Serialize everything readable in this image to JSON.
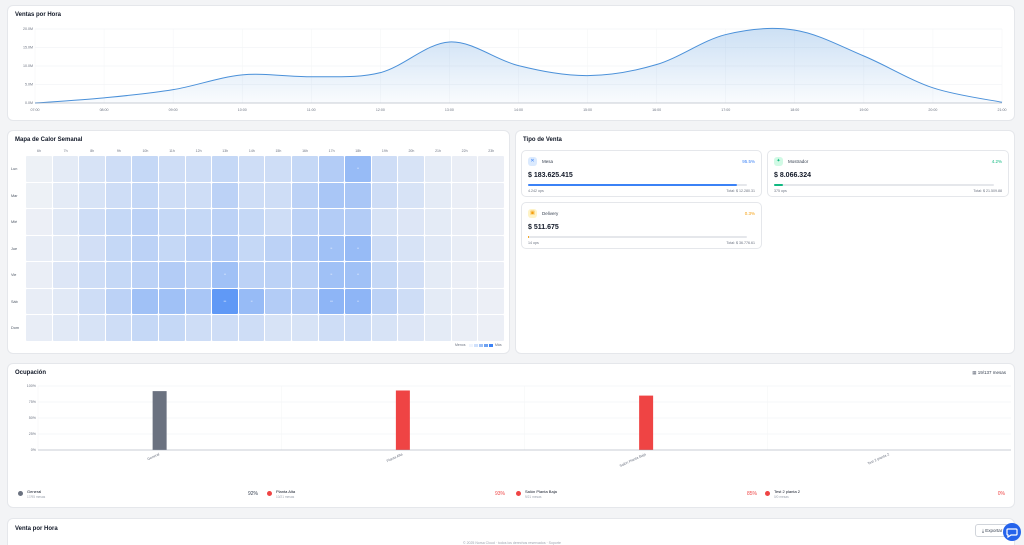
{
  "ventas_por_hora": {
    "title": "Ventas por Hora",
    "chart_data": {
      "type": "area",
      "x": [
        "07:00",
        "08:00",
        "09:00",
        "10:00",
        "11:00",
        "12:00",
        "13:00",
        "14:00",
        "15:00",
        "16:00",
        "17:00",
        "18:00",
        "19:00",
        "20:00",
        "21:00"
      ],
      "series": [
        {
          "values": [
            0,
            1.4,
            3.6,
            7.6,
            7.1,
            8.2,
            16.5,
            10.1,
            7.4,
            10.4,
            18.5,
            19.7,
            12.7,
            4.1,
            0.2
          ]
        }
      ],
      "yticks": [
        "0.0M",
        "5.0M",
        "10.0M",
        "15.0M",
        "20.0M"
      ],
      "ylim": [
        0,
        20
      ],
      "grid": true,
      "color": "#4a90d9"
    }
  },
  "mapa_calor": {
    "title": "Mapa de Calor Semanal",
    "hours": [
      "6h",
      "7h",
      "8h",
      "9h",
      "10h",
      "11h",
      "12h",
      "13h",
      "14h",
      "15h",
      "16h",
      "17h",
      "18h",
      "19h",
      "20h",
      "21h",
      "22h",
      "23h"
    ],
    "days": [
      "Lun",
      "Mar",
      "Mié",
      "Jue",
      "Vie",
      "Sáb",
      "Dom"
    ],
    "intensity": [
      [
        0.03,
        0.08,
        0.15,
        0.2,
        0.25,
        0.2,
        0.2,
        0.25,
        0.2,
        0.2,
        0.25,
        0.35,
        0.5,
        0.2,
        0.15,
        0.08,
        0.05,
        0.04
      ],
      [
        0.03,
        0.08,
        0.15,
        0.2,
        0.25,
        0.2,
        0.2,
        0.3,
        0.2,
        0.2,
        0.3,
        0.4,
        0.4,
        0.2,
        0.15,
        0.08,
        0.05,
        0.04
      ],
      [
        0.04,
        0.1,
        0.2,
        0.25,
        0.3,
        0.25,
        0.25,
        0.3,
        0.25,
        0.2,
        0.3,
        0.35,
        0.35,
        0.15,
        0.12,
        0.08,
        0.05,
        0.04
      ],
      [
        0.06,
        0.08,
        0.18,
        0.25,
        0.3,
        0.25,
        0.3,
        0.35,
        0.25,
        0.3,
        0.35,
        0.45,
        0.5,
        0.2,
        0.15,
        0.1,
        0.06,
        0.04
      ],
      [
        0.05,
        0.12,
        0.2,
        0.25,
        0.3,
        0.35,
        0.3,
        0.45,
        0.3,
        0.3,
        0.3,
        0.45,
        0.45,
        0.25,
        0.18,
        0.08,
        0.05,
        0.04
      ],
      [
        0.06,
        0.1,
        0.2,
        0.3,
        0.45,
        0.45,
        0.4,
        0.8,
        0.5,
        0.35,
        0.35,
        0.55,
        0.55,
        0.3,
        0.2,
        0.08,
        0.06,
        0.04
      ],
      [
        0.06,
        0.1,
        0.15,
        0.2,
        0.25,
        0.25,
        0.2,
        0.2,
        0.2,
        0.15,
        0.15,
        0.2,
        0.2,
        0.15,
        0.12,
        0.08,
        0.05,
        0.04
      ]
    ],
    "labels": [
      {
        "row": 0,
        "col": 12,
        "text": "••"
      },
      {
        "row": 3,
        "col": 11,
        "text": "••"
      },
      {
        "row": 3,
        "col": 12,
        "text": "••"
      },
      {
        "row": 4,
        "col": 7,
        "text": "••"
      },
      {
        "row": 4,
        "col": 11,
        "text": "••"
      },
      {
        "row": 4,
        "col": 12,
        "text": "••"
      },
      {
        "row": 5,
        "col": 7,
        "text": "•••"
      },
      {
        "row": 5,
        "col": 8,
        "text": "••"
      },
      {
        "row": 5,
        "col": 11,
        "text": "•••"
      },
      {
        "row": 5,
        "col": 12,
        "text": "••"
      }
    ],
    "legend_less": "Menos",
    "legend_more": "Más"
  },
  "tipo_venta": {
    "title": "Tipo de Venta",
    "cards": [
      {
        "name": "Mesa",
        "icon": "utensils-icon",
        "pct": "95.5%",
        "amount": "$ 183.625.415",
        "ops": "4.242 ops",
        "total": "Total: $ 12.280.31",
        "progress": 0.955,
        "color": "#3b82f6",
        "bg": "#dbeafe",
        "pctColor": "#3b82f6"
      },
      {
        "name": "Mostrador",
        "icon": "store-icon",
        "pct": "4.2%",
        "amount": "$ 8.066.324",
        "ops": "375 ops",
        "total": "Total: $ 21.509.88",
        "progress": 0.042,
        "color": "#10b981",
        "bg": "#d1fae5",
        "pctColor": "#10b981"
      },
      {
        "name": "Delivery",
        "icon": "bag-icon",
        "pct": "0.3%",
        "amount": "$ 511.675",
        "ops": "14 ops",
        "total": "Total: $ 36.776.61",
        "progress": 0.003,
        "color": "#f59e0b",
        "bg": "#fef3c7",
        "pctColor": "#f59e0b"
      }
    ]
  },
  "ocupacion": {
    "title": "Ocupación",
    "mesas": "19/137 mesas",
    "chart_data": {
      "type": "bar",
      "categories": [
        "General",
        "Planta Alta",
        "Salón Planta Baja",
        "Test 2 planta 2"
      ],
      "values": [
        92,
        93,
        85,
        0
      ],
      "colors": [
        "#6b7280",
        "#ef4444",
        "#ef4444",
        "#ef4444"
      ],
      "yticks": [
        "0%",
        "25%",
        "50%",
        "75%",
        "100%"
      ],
      "ylim": [
        0,
        100
      ]
    },
    "legend": [
      {
        "name": "General",
        "count": "17/95 mesas",
        "pct": "92%",
        "color": "#6b7280",
        "pctColor": "#374151"
      },
      {
        "name": "Planta Alta",
        "count": "10/21 mesas",
        "pct": "93%",
        "color": "#ef4444",
        "pctColor": "#ef4444"
      },
      {
        "name": "Salón Planta Baja",
        "count": "9/21 mesas",
        "pct": "85%",
        "color": "#ef4444",
        "pctColor": "#ef4444"
      },
      {
        "name": "Test 2 planta 2",
        "count": "0/0 mesas",
        "pct": "0%",
        "color": "#ef4444",
        "pctColor": "#ef4444"
      }
    ]
  },
  "venta_por_hora": {
    "title": "Venta por Hora",
    "export_label": "Exportar"
  },
  "footer": "© 2025 Norsa Cloud · todos los derechos reservados · Soporte"
}
